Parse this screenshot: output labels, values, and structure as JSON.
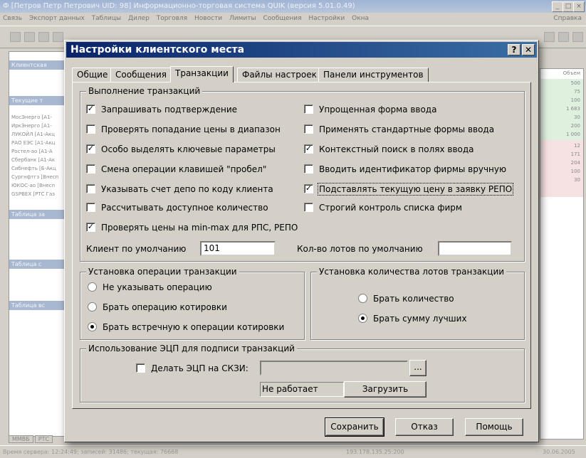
{
  "app": {
    "title": "Ф [Петров Петр Петрович UID: 98] Информационно-торговая система QUIK (версия 5.01.0.49)",
    "menu": [
      "Связь",
      "Экспорт данных",
      "Таблицы",
      "Дилер",
      "Торговля",
      "Новости",
      "Лимиты",
      "Сообщения",
      "Настройки",
      "Окна"
    ],
    "help": "Справка",
    "status": "Время сервера: 12:24:49; записей: 31486; текущая: 76668",
    "status_ip": "193.178.135.25:200",
    "status_date": "30.06.2005",
    "bottom_tabs": [
      "ММВБ",
      "РТС"
    ],
    "left_panels": [
      "Клиентская",
      "Текущие т",
      "Таблица за",
      "Таблица с",
      "Таблица вс"
    ],
    "left_rows": [
      "МосЭнерго [А1-",
      "ИркЭнерго [А1-",
      "ЛУКОЙЛ [А1-Акц",
      "РАО ЕЭС [А1-Акц",
      "Ростел-ао [А1-А",
      "Сбербанк [А1-Ак",
      "Сибнефть [Б-Акц",
      "Сургнфтгз [Внесп",
      "ЮКОС-ао [Внесп",
      "GSPBEX [РТС Газ"
    ],
    "right_values": [
      "500",
      "75",
      "100",
      "1 683",
      "30",
      "200",
      "1 000",
      "12",
      "171",
      "204",
      "100",
      "30"
    ],
    "right_header": "Объем"
  },
  "dialog": {
    "title": "Настройки клиентского места",
    "help_button": "?",
    "close_button": "✕",
    "tabs": [
      {
        "label": "Общие",
        "active": false
      },
      {
        "label": "Сообщения",
        "active": false
      },
      {
        "label": "Транзакции",
        "active": true
      },
      {
        "label": "Файлы настроек",
        "active": false
      },
      {
        "label": "Панели инструментов",
        "active": false
      }
    ],
    "exec_group": {
      "title": "Выполнение транзакций",
      "left_checks": [
        {
          "label": "Запрашивать подтверждение",
          "checked": true
        },
        {
          "label": "Проверять попадание цены в диапазон",
          "checked": false
        },
        {
          "label": "Особо выделять ключевые параметры",
          "checked": true
        },
        {
          "label": "Смена операции клавишей \"пробел\"",
          "checked": false
        },
        {
          "label": "Указывать счет депо по коду клиента",
          "checked": false
        },
        {
          "label": "Рассчитывать доступное количество",
          "checked": false
        },
        {
          "label": "Проверять цены на min-max для РПС, РЕПО",
          "checked": true
        }
      ],
      "right_checks": [
        {
          "label": "Упрощенная форма ввода",
          "checked": false
        },
        {
          "label": "Применять стандартные формы ввода",
          "checked": false
        },
        {
          "label": "Контекстный поиск в полях ввода",
          "checked": true
        },
        {
          "label": "Вводить идентификатор фирмы вручную",
          "checked": false
        },
        {
          "label": "Подставлять текущую цену в заявку РЕПО",
          "checked": true
        },
        {
          "label": "Строгий контроль списка фирм",
          "checked": false
        }
      ],
      "client_label": "Клиент по умолчанию",
      "client_value": "101",
      "lots_label": "Кол-во лотов по умолчанию",
      "lots_value": ""
    },
    "op_group": {
      "title": "Установка операции транзакции",
      "options": [
        {
          "label": "Не указывать операцию",
          "selected": false
        },
        {
          "label": "Брать операцию котировки",
          "selected": false
        },
        {
          "label": "Брать встречную к операции котировки",
          "selected": true
        }
      ]
    },
    "lots_group": {
      "title": "Установка количества лотов транзакции",
      "options": [
        {
          "label": "Брать количество",
          "selected": false
        },
        {
          "label": "Брать сумму лучших",
          "selected": true
        }
      ]
    },
    "sign_group": {
      "title": "Использование ЭЦП для подписи транзакций",
      "check_label": "Делать ЭЦП на СКЗИ:",
      "checked": false,
      "path_value": "",
      "browse_label": "...",
      "status_text": "Не работает",
      "load_label": "Загрузить"
    },
    "buttons": {
      "save": "Сохранить",
      "cancel": "Отказ",
      "help": "Помощь"
    }
  }
}
